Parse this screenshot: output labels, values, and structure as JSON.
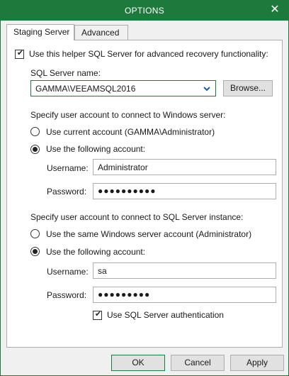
{
  "window": {
    "title": "OPTIONS",
    "close_glyph": "✕",
    "accent_color": "#1e7a3c"
  },
  "tabs": [
    {
      "label": "Staging Server",
      "active": true
    },
    {
      "label": "Advanced",
      "active": false
    }
  ],
  "staging": {
    "use_helper": {
      "label": "Use this helper SQL Server for advanced recovery functionality:",
      "checked": true
    },
    "sql_server_name_label": "SQL Server name:",
    "sql_server_name_value": "GAMMA\\VEEAMSQL2016",
    "browse_label": "Browse...",
    "windows_account": {
      "heading": "Specify user account to connect to Windows server:",
      "option_current": {
        "label": "Use current account (GAMMA\\Administrator)",
        "selected": false
      },
      "option_following": {
        "label": "Use the following account:",
        "selected": true
      },
      "username_label": "Username:",
      "username_value": "Administrator",
      "password_label": "Password:",
      "password_value": "●●●●●●●●●●"
    },
    "sql_account": {
      "heading": "Specify user account to connect to SQL Server instance:",
      "option_same": {
        "label": "Use the same Windows server account (Administrator)",
        "selected": false
      },
      "option_following": {
        "label": "Use the following account:",
        "selected": true
      },
      "username_label": "Username:",
      "username_value": "sa",
      "password_label": "Password:",
      "password_value": "●●●●●●●●●",
      "sql_auth": {
        "label": "Use SQL Server authentication",
        "checked": true
      }
    }
  },
  "footer": {
    "ok_label": "OK",
    "cancel_label": "Cancel",
    "apply_label": "Apply"
  }
}
